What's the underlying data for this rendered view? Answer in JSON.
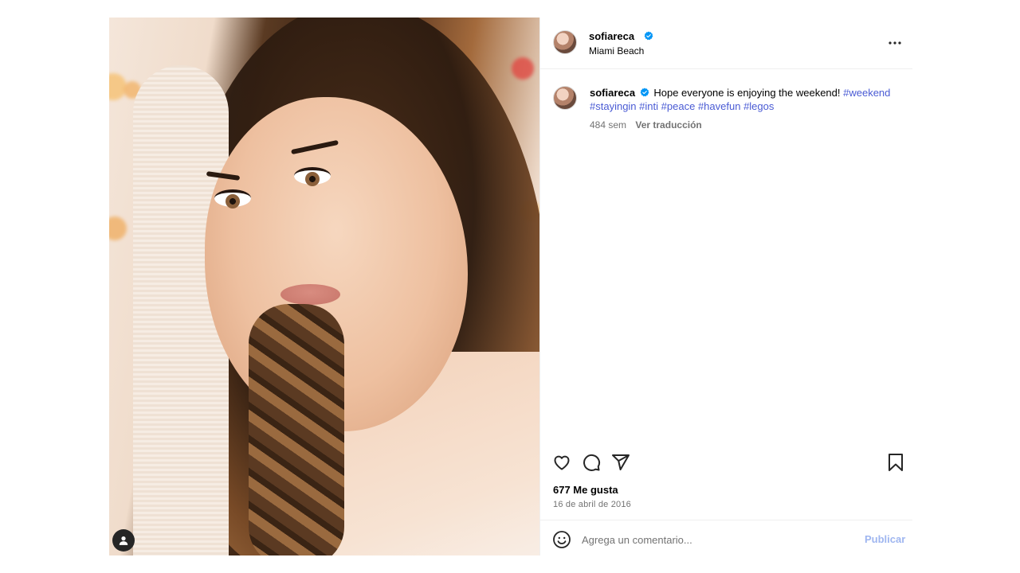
{
  "post": {
    "header": {
      "username": "sofiareca",
      "location": "Miami Beach"
    },
    "caption": {
      "username": "sofiareca",
      "text": "Hope everyone is enjoying the weekend!",
      "hashtags": [
        "#weekend",
        "#stayingin",
        "#inti",
        "#peace",
        "#havefun",
        "#legos"
      ],
      "time_ago": "484 sem",
      "translate_label": "Ver traducción"
    },
    "likes_label": "677 Me gusta",
    "date_label": "16 de abril de 2016",
    "comment": {
      "placeholder": "Agrega un comentario...",
      "publish_label": "Publicar"
    }
  },
  "icons": {
    "verified": "verified-badge-icon",
    "more": "more-options-icon",
    "like": "heart-icon",
    "comment": "comment-icon",
    "share": "share-icon",
    "save": "bookmark-icon",
    "emoji": "emoji-icon",
    "tags": "user-tag-icon"
  },
  "colors": {
    "verified_blue": "#0095f6",
    "hashtag": "#4a5bd4",
    "secondary_text": "#737373",
    "publish_disabled": "#9fb6f0"
  }
}
